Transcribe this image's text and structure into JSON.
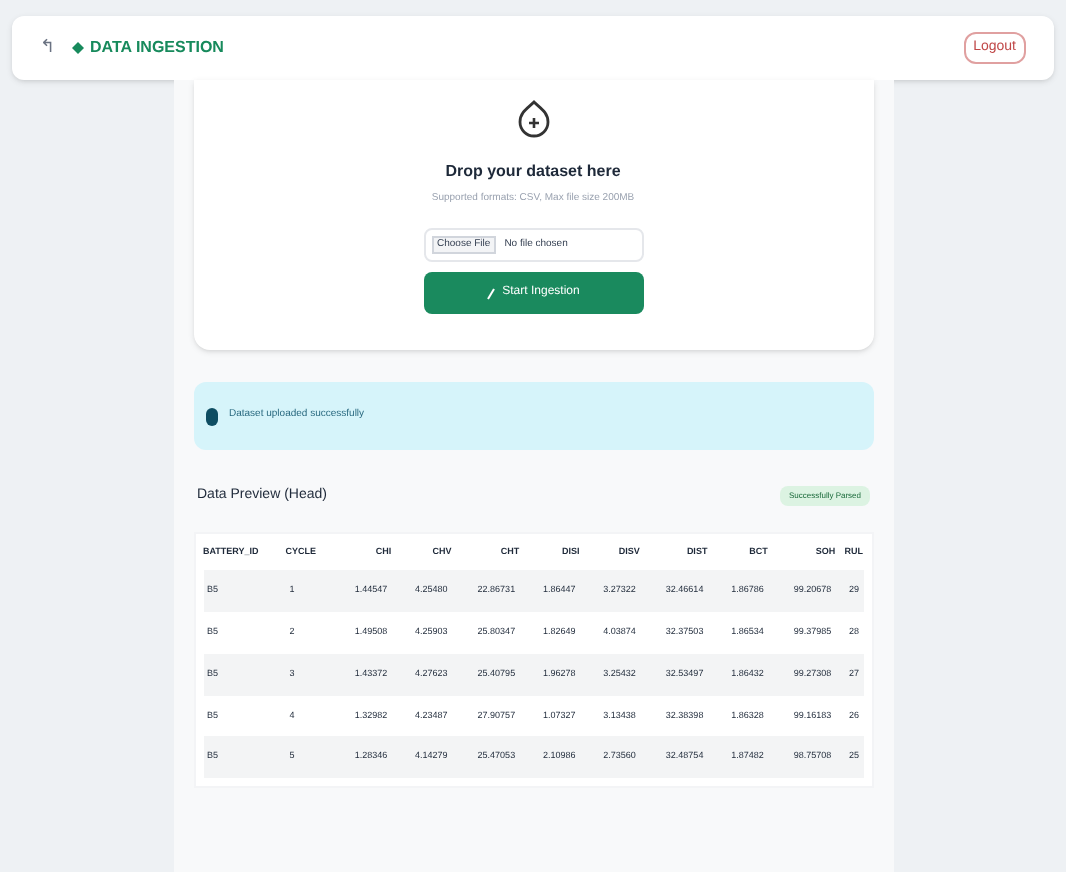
{
  "header": {
    "back_glyph": "↰",
    "title": "DATA INGESTION",
    "logout": "Logout"
  },
  "upload": {
    "title": "Drop your dataset here",
    "subtitle": "Supported formats: CSV, Max file size 200MB",
    "choose": "Choose File",
    "file_status": "No file chosen",
    "button": "Start Ingestion"
  },
  "alert": {
    "text": "Dataset uploaded successfully"
  },
  "preview": {
    "title": "Data Preview (Head)",
    "badge": "Successfully Parsed",
    "table": {
      "columns": [
        "BATTERY_ID",
        "CYCLE",
        "CHI",
        "CHV",
        "CHT",
        "DISI",
        "DISV",
        "DIST",
        "BCT",
        "SOH",
        "RUL"
      ],
      "rows": [
        [
          "B5",
          "1",
          "1.44547",
          "4.25480",
          "22.86731",
          "1.86447",
          "3.27322",
          "32.46614",
          "1.86786",
          "99.20678",
          "29"
        ],
        [
          "B5",
          "2",
          "1.49508",
          "4.25903",
          "25.80347",
          "1.82649",
          "4.03874",
          "32.37503",
          "1.86534",
          "99.37985",
          "28"
        ],
        [
          "B5",
          "3",
          "1.43372",
          "4.27623",
          "25.40795",
          "1.96278",
          "3.25432",
          "32.53497",
          "1.86432",
          "99.27308",
          "27"
        ],
        [
          "B5",
          "4",
          "1.32982",
          "4.23487",
          "27.90757",
          "1.07327",
          "3.13438",
          "32.38398",
          "1.86328",
          "99.16183",
          "26"
        ],
        [
          "B5",
          "5",
          "1.28346",
          "4.14279",
          "25.47053",
          "2.10986",
          "2.73560",
          "32.48754",
          "1.87482",
          "98.75708",
          "25"
        ]
      ]
    }
  }
}
